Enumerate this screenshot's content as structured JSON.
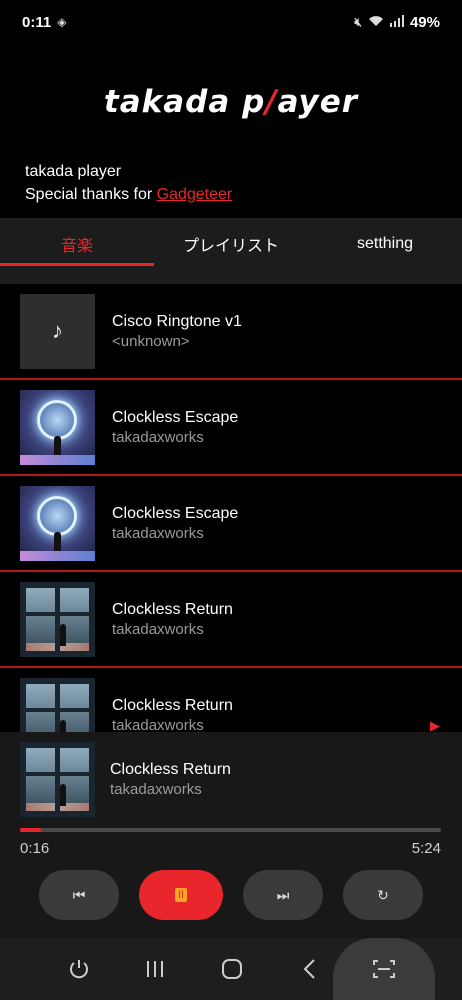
{
  "status_bar": {
    "time": "0:11",
    "battery": "49%",
    "icons": [
      "data-saver-icon",
      "mute-icon",
      "wifi-icon",
      "signal-icon"
    ]
  },
  "logo": {
    "prefix": "takada p",
    "accent": "/",
    "suffix": "ayer"
  },
  "info": {
    "line1": "takada player",
    "line2_prefix": "Special thanks for ",
    "link": "Gadgeteer"
  },
  "tabs": [
    {
      "label": "音楽",
      "active": true
    },
    {
      "label": "プレイリスト",
      "active": false
    },
    {
      "label": "setthing",
      "active": false
    }
  ],
  "songs": [
    {
      "title": "Cisco Ringtone v1",
      "artist": "<unknown>",
      "art": "plain",
      "icon": "♪"
    },
    {
      "title": "Clockless Escape",
      "artist": "takadaxworks",
      "art": "escape"
    },
    {
      "title": "Clockless Escape",
      "artist": "takadaxworks",
      "art": "escape"
    },
    {
      "title": "Clockless Return",
      "artist": "takadaxworks",
      "art": "return"
    },
    {
      "title": "Clockless Return",
      "artist": "takadaxworks",
      "art": "return",
      "playing": true
    }
  ],
  "now_playing": {
    "title": "Clockless Return",
    "artist": "takadaxworks",
    "current_time": "0:16",
    "duration": "5:24",
    "progress_fraction": 0.05
  },
  "controls": {
    "prev": "⏮",
    "play_pause": "II",
    "next": "⏭",
    "repeat": "↻"
  },
  "colors": {
    "accent": "#e8262b",
    "background": "#000000"
  }
}
